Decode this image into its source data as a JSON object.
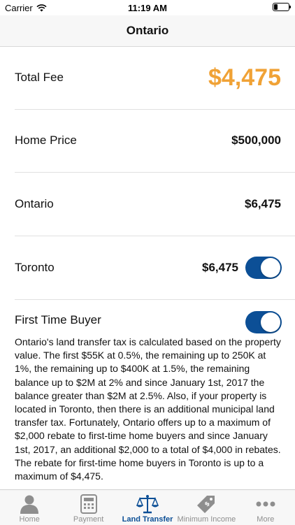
{
  "status_bar": {
    "carrier": "Carrier",
    "time": "11:19 AM"
  },
  "nav": {
    "title": "Ontario"
  },
  "rows": {
    "total_fee": {
      "label": "Total Fee",
      "value": "$4,475"
    },
    "home_price": {
      "label": "Home Price",
      "value": "$500,000"
    },
    "ontario": {
      "label": "Ontario",
      "value": "$6,475"
    },
    "toronto": {
      "label": "Toronto",
      "value": "$6,475",
      "toggle_on": true
    },
    "first_time_buyer": {
      "label": "First Time Buyer",
      "toggle_on": true
    }
  },
  "description": "Ontario's land transfer tax is calculated based on the property value. The first $55K at 0.5%, the remaining up to 250K at 1%, the remaining up to $400K at 1.5%, the remaining balance up to $2M at 2% and since January 1st, 2017 the balance greater than $2M at 2.5%. Also, if your property is located in Toronto, then there is an additional municipal land transfer tax. Fortunately, Ontario offers up to a maximum of $2,000 rebate to first-time home buyers and since January 1st, 2017, an additional $2,000 to a total of $4,000 in rebates. The rebate for first-time home buyers in Toronto is up to a maximum of $4,475.",
  "tabs": [
    {
      "label": "Home",
      "icon": "person-icon",
      "active": false
    },
    {
      "label": "Payment",
      "icon": "calculator-icon",
      "active": false
    },
    {
      "label": "Land Transfer",
      "icon": "scales-icon",
      "active": true
    },
    {
      "label": "Minimum Income",
      "icon": "price-tag-icon",
      "active": false
    },
    {
      "label": "More",
      "icon": "more-icon",
      "active": false
    }
  ],
  "colors": {
    "accent": "#0c4f96",
    "total_fee": "#f0a236"
  }
}
